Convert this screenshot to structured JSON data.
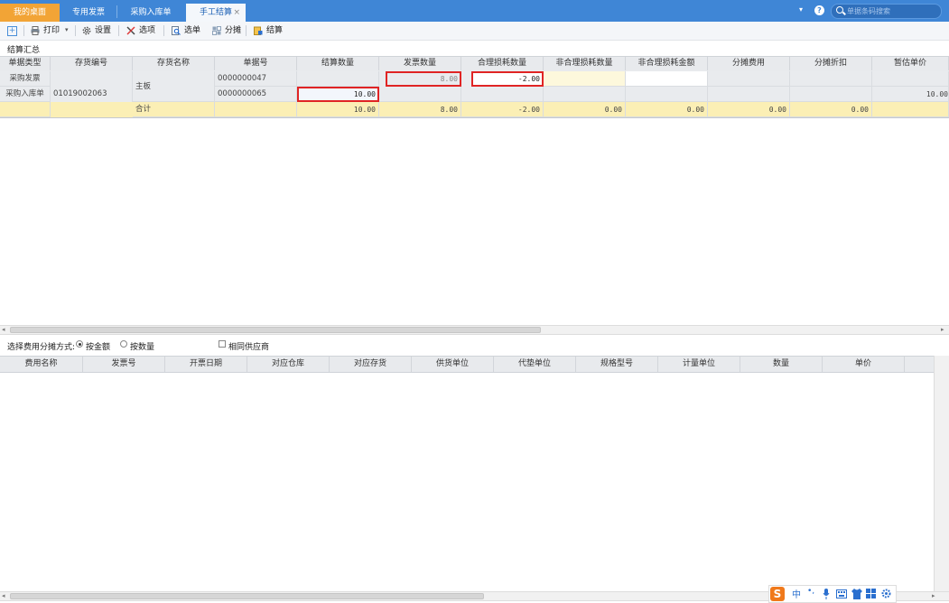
{
  "tabs": [
    {
      "label": "我的桌面"
    },
    {
      "label": "专用发票"
    },
    {
      "label": "采购入库单"
    },
    {
      "label": "手工结算"
    }
  ],
  "search": {
    "placeholder": "单据条码搜索"
  },
  "toolbar": {
    "print": "打印",
    "settings": "设置",
    "options": "选项",
    "select": "选单",
    "allocate": "分摊",
    "settle": "结算"
  },
  "summary": {
    "title": "结算汇总",
    "columns": [
      "单据类型",
      "存货编号",
      "存货名称",
      "单据号",
      "结算数量",
      "发票数量",
      "合理损耗数量",
      "非合理损耗数量",
      "非合理损耗金额",
      "分摊费用",
      "分摊折扣",
      "暂估单价"
    ],
    "rows": [
      {
        "type": "采购发票",
        "code": "",
        "name": "",
        "doc_no": "0000000047",
        "settle_qty": "",
        "invoice_qty": "8.00",
        "loss_qty": "-2.00",
        "non_loss_qty": "",
        "non_loss_amt": "",
        "alloc_fee": "",
        "alloc_disc": "",
        "est_price": ""
      },
      {
        "type": "采购入库单",
        "code": "01019002063",
        "name": "主板",
        "doc_no": "0000000065",
        "settle_qty": "10.00",
        "invoice_qty": "",
        "loss_qty": "",
        "non_loss_qty": "",
        "non_loss_amt": "",
        "alloc_fee": "",
        "alloc_disc": "",
        "est_price": "10.00"
      }
    ],
    "total": {
      "label": "合计",
      "settle_qty": "10.00",
      "invoice_qty": "8.00",
      "loss_qty": "-2.00",
      "non_loss_qty": "0.00",
      "non_loss_amt": "0.00",
      "alloc_fee": "0.00",
      "alloc_disc": "0.00"
    }
  },
  "allocation": {
    "label": "选择费用分摊方式:",
    "by_amount": "按金额",
    "by_quantity": "按数量",
    "same_supplier": "相同供应商",
    "selected": "by_amount"
  },
  "fees": {
    "columns": [
      "费用名称",
      "发票号",
      "开票日期",
      "对应仓库",
      "对应存货",
      "供货单位",
      "代垫单位",
      "规格型号",
      "计量单位",
      "数量",
      "单价"
    ]
  },
  "ime": {
    "logo": "S",
    "mode": "中",
    "punct": "•,"
  }
}
